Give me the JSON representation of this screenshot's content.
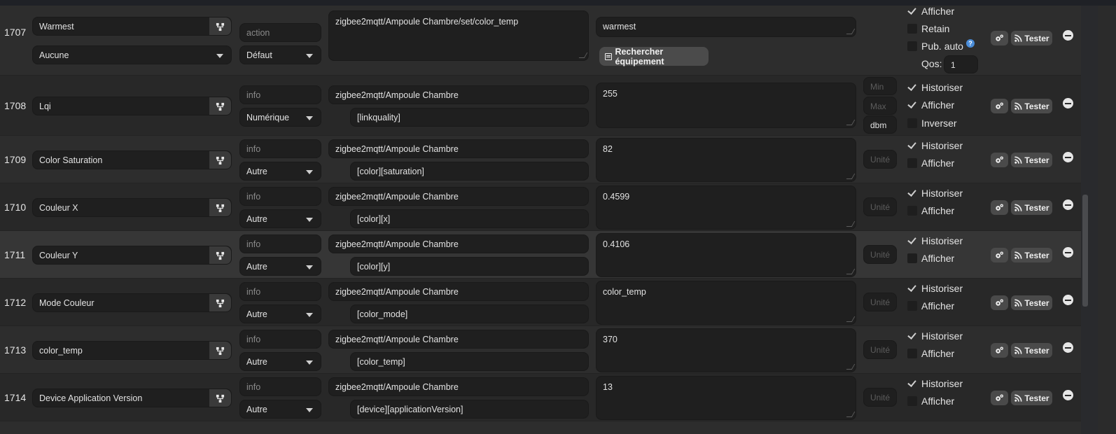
{
  "rows": [
    {
      "id": "1707",
      "name": "Warmest",
      "type": "action",
      "subtype": "Aucune",
      "generic": "Défaut",
      "topic": "zigbee2mqtt/Ampoule Chambre/set/color_temp",
      "json_path": "",
      "value": "warmest",
      "search_button": "Rechercher équipement",
      "options": [
        {
          "label": "Afficher",
          "checked": true
        },
        {
          "label": "Retain",
          "checked": false
        },
        {
          "label": "Pub. auto",
          "checked": false,
          "help": true
        }
      ],
      "qos_label": "Qos:",
      "qos_value": "1"
    },
    {
      "id": "1708",
      "name": "Lqi",
      "type": "info",
      "generic": "Numérique",
      "topic": "zigbee2mqtt/Ampoule Chambre",
      "json_path": "[linkquality]",
      "value": "255",
      "min_placeholder": "Min",
      "max_placeholder": "Max",
      "unit": "dbm",
      "options": [
        {
          "label": "Historiser",
          "checked": true
        },
        {
          "label": "Afficher",
          "checked": true
        },
        {
          "label": "Inverser",
          "checked": false
        }
      ]
    },
    {
      "id": "1709",
      "name": "Color Saturation",
      "type": "info",
      "generic": "Autre",
      "topic": "zigbee2mqtt/Ampoule Chambre",
      "json_path": "[color][saturation]",
      "value": "82",
      "unit_placeholder": "Unité",
      "options": [
        {
          "label": "Historiser",
          "checked": true
        },
        {
          "label": "Afficher",
          "checked": false
        }
      ]
    },
    {
      "id": "1710",
      "name": "Couleur X",
      "type": "info",
      "generic": "Autre",
      "topic": "zigbee2mqtt/Ampoule Chambre",
      "json_path": "[color][x]",
      "value": "0.4599",
      "unit_placeholder": "Unité",
      "options": [
        {
          "label": "Historiser",
          "checked": true
        },
        {
          "label": "Afficher",
          "checked": false
        }
      ]
    },
    {
      "id": "1711",
      "name": "Couleur Y",
      "type": "info",
      "generic": "Autre",
      "topic": "zigbee2mqtt/Ampoule Chambre",
      "json_path": "[color][y]",
      "value": "0.4106",
      "unit_placeholder": "Unité",
      "options": [
        {
          "label": "Historiser",
          "checked": true
        },
        {
          "label": "Afficher",
          "checked": false
        }
      ]
    },
    {
      "id": "1712",
      "name": "Mode Couleur",
      "type": "info",
      "generic": "Autre",
      "topic": "zigbee2mqtt/Ampoule Chambre",
      "json_path": "[color_mode]",
      "value": "color_temp",
      "unit_placeholder": "Unité",
      "options": [
        {
          "label": "Historiser",
          "checked": true
        },
        {
          "label": "Afficher",
          "checked": false
        }
      ]
    },
    {
      "id": "1713",
      "name": "color_temp",
      "type": "info",
      "generic": "Autre",
      "topic": "zigbee2mqtt/Ampoule Chambre",
      "json_path": "[color_temp]",
      "value": "370",
      "unit_placeholder": "Unité",
      "options": [
        {
          "label": "Historiser",
          "checked": true
        },
        {
          "label": "Afficher",
          "checked": false
        }
      ]
    },
    {
      "id": "1714",
      "name": "Device Application Version",
      "type": "info",
      "generic": "Autre",
      "topic": "zigbee2mqtt/Ampoule Chambre",
      "json_path": "[device][applicationVersion]",
      "value": "13",
      "unit_placeholder": "Unité",
      "options": [
        {
          "label": "Historiser",
          "checked": true
        },
        {
          "label": "Afficher",
          "checked": false
        }
      ]
    }
  ],
  "buttons": {
    "tester": "Tester"
  },
  "icons": {
    "configure": "gears-icon",
    "test": "rss-icon",
    "remove": "minus-circle-icon",
    "name_action": "network-icon"
  }
}
